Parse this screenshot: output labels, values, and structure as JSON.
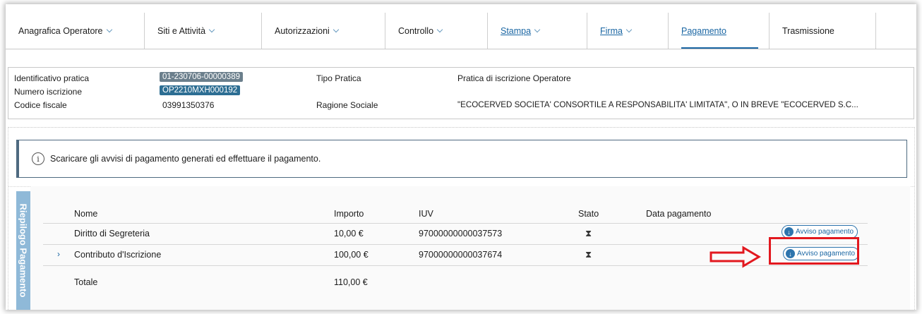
{
  "tabs": [
    {
      "label": "Anagrafica Operatore",
      "dropdown": true,
      "link": false,
      "active": false
    },
    {
      "label": "Siti e Attività",
      "dropdown": true,
      "link": false,
      "active": false
    },
    {
      "label": "Autorizzazioni",
      "dropdown": true,
      "link": false,
      "active": false
    },
    {
      "label": "Controllo",
      "dropdown": true,
      "link": false,
      "active": false
    },
    {
      "label": "Stampa",
      "dropdown": true,
      "link": true,
      "active": false
    },
    {
      "label": "Firma",
      "dropdown": true,
      "link": true,
      "active": false
    },
    {
      "label": "Pagamento",
      "dropdown": false,
      "link": true,
      "active": true
    },
    {
      "label": "Trasmissione",
      "dropdown": false,
      "link": false,
      "active": false
    }
  ],
  "info": {
    "identificativo_label": "Identificativo pratica",
    "identificativo_value": "01-230706-00000389",
    "numero_label": "Numero iscrizione",
    "numero_value": "OP2210MXH000192",
    "codice_label": "Codice fiscale",
    "codice_value": "03991350376",
    "tipo_label": "Tipo Pratica",
    "tipo_value": "Pratica di iscrizione Operatore",
    "ragione_label": "Ragione Sociale",
    "ragione_value": "\"ECOCERVED SOCIETA' CONSORTILE A RESPONSABILITA' LIMITATA\", O IN BREVE \"ECOCERVED S.C..."
  },
  "alert": {
    "icon": "info-circle-icon",
    "text": "Scaricare gli avvisi di pagamento generati ed effettuare il pagamento."
  },
  "payment": {
    "side_label": "Riepilogo Pagamento",
    "headers": {
      "nome": "Nome",
      "importo": "Importo",
      "iuv": "IUV",
      "stato": "Stato",
      "data": "Data pagamento"
    },
    "rows": [
      {
        "nome": "Diritto di Segreteria",
        "importo": "10,00 €",
        "iuv": "97000000000037573",
        "stato_icon": "hourglass-icon",
        "button": "Avviso pagamento"
      },
      {
        "nome": "Contributo d'Iscrizione",
        "importo": "100,00 €",
        "iuv": "97000000000037674",
        "stato_icon": "hourglass-icon",
        "button": "Avviso pagamento",
        "expandable": true
      }
    ],
    "totale_label": "Totale",
    "totale_value": "110,00 €"
  },
  "colors": {
    "accent": "#1a66a3",
    "highlight": "#e2181f",
    "sidebar": "#8fb9d8"
  }
}
